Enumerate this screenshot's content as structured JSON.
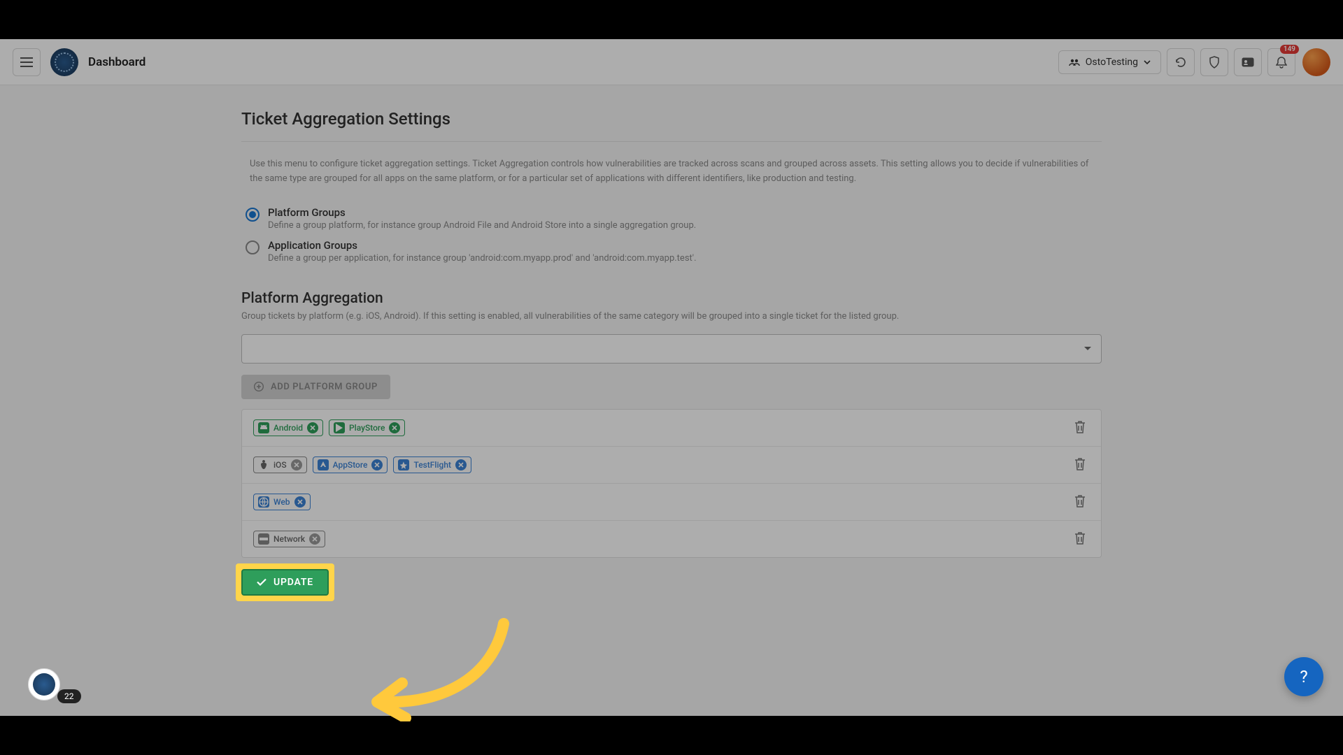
{
  "header": {
    "title": "Dashboard",
    "workspace": "OstoTesting",
    "notification_count": "149",
    "side_count": "22"
  },
  "settings": {
    "title": "Ticket Aggregation Settings",
    "description": "Use this menu to configure ticket aggregation settings. Ticket Aggregation controls how vulnerabilities are tracked across scans and grouped across assets. This setting allows you to decide if vulnerabilities of the same type are grouped for all apps on the same platform, or for a particular set of applications with different identifiers, like production and testing.",
    "radios": {
      "platform": {
        "label": "Platform Groups",
        "sub": "Define a group platform, for instance group Android File and Android Store into a single aggregation group."
      },
      "application": {
        "label": "Application Groups",
        "sub": "Define a group per application, for instance group 'android:com.myapp.prod' and 'android:com.myapp.test'."
      }
    },
    "platform_agg": {
      "title": "Platform Aggregation",
      "sub": "Group tickets by platform (e.g. iOS, Android). If this setting is enabled, all vulnerabilities of the same category will be grouped into a single ticket for the listed group.",
      "add_button": "ADD PLATFORM GROUP"
    },
    "groups": [
      {
        "chips": [
          {
            "label": "Android",
            "color": "green",
            "icon": "android"
          },
          {
            "label": "PlayStore",
            "color": "green",
            "icon": "play"
          }
        ]
      },
      {
        "chips": [
          {
            "label": "iOS",
            "color": "gray",
            "icon": "apple"
          },
          {
            "label": "AppStore",
            "color": "blue",
            "icon": "appstore"
          },
          {
            "label": "TestFlight",
            "color": "blue",
            "icon": "testflight"
          }
        ]
      },
      {
        "chips": [
          {
            "label": "Web",
            "color": "blue",
            "icon": "globe"
          }
        ]
      },
      {
        "chips": [
          {
            "label": "Network",
            "color": "gray",
            "icon": "network"
          }
        ]
      }
    ],
    "update_button": "UPDATE"
  }
}
